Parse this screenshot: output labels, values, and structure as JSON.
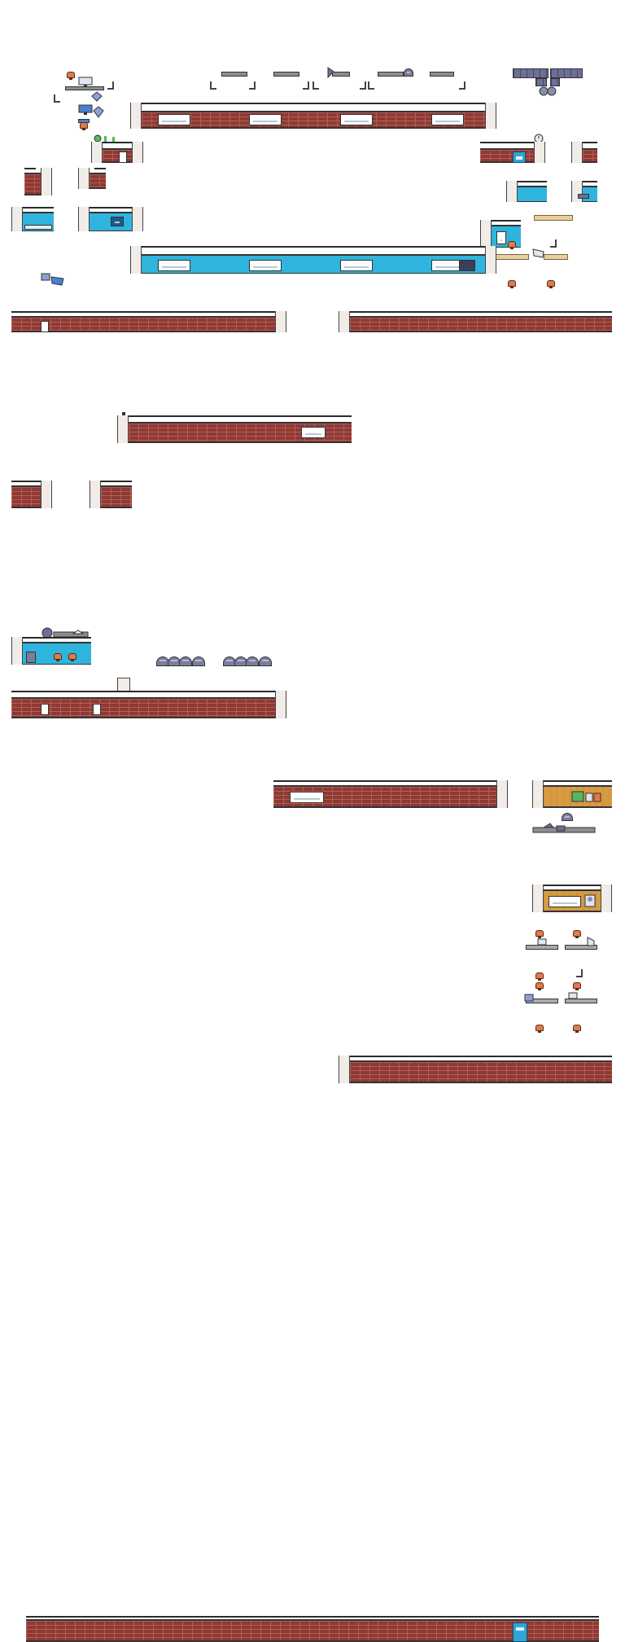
{
  "scene": {
    "kind": "isometric-room-tileset",
    "background": "#ffffff",
    "colors": {
      "brick": "#8e3a34",
      "brick_mortar": "#b65d55",
      "blue_wall": "#2fb4de",
      "wood_wall": "#d89b42",
      "post": "#f1ece8",
      "outline": "#2b2b2b",
      "chair": "#e07a4a",
      "metal": "#8d8d8d",
      "slate": "#6c6f96"
    }
  },
  "icons": {
    "monitor": "monitor-icon",
    "plant": "plant-icon",
    "clock": "clock-icon",
    "lamp": "lamp-icon",
    "robot": "robot-icon",
    "printer": "printer-icon",
    "portrait": "portrait-icon"
  }
}
